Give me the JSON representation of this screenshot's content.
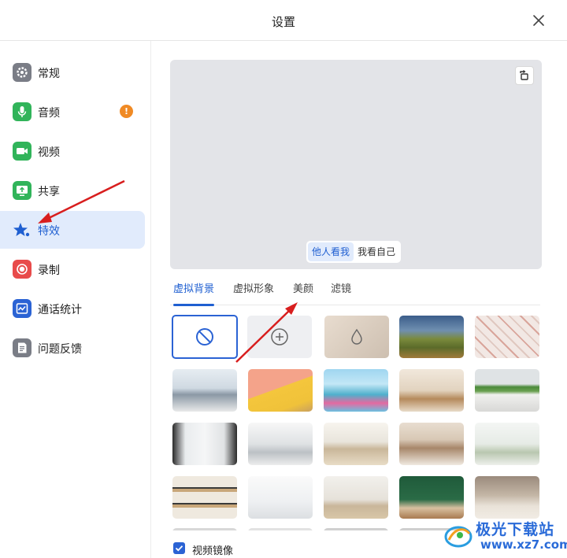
{
  "window": {
    "title": "设置"
  },
  "sidebar": {
    "items": [
      {
        "key": "general",
        "label": "常规",
        "icon": "gear-icon",
        "color": "#7a7d86",
        "active": false
      },
      {
        "key": "audio",
        "label": "音频",
        "icon": "microphone-icon",
        "color": "#31b45a",
        "active": false,
        "badge": "!"
      },
      {
        "key": "video",
        "label": "视频",
        "icon": "camera-icon",
        "color": "#31b45a",
        "active": false
      },
      {
        "key": "share",
        "label": "共享",
        "icon": "screen-share-icon",
        "color": "#31b45a",
        "active": false
      },
      {
        "key": "effects",
        "label": "特效",
        "icon": "star-effects-icon",
        "color": "#1f5fd1",
        "active": true
      },
      {
        "key": "record",
        "label": "录制",
        "icon": "record-icon",
        "color": "#e84b4b",
        "active": false
      },
      {
        "key": "stats",
        "label": "通话统计",
        "icon": "stats-chart-icon",
        "color": "#2b63d4",
        "active": false
      },
      {
        "key": "feedback",
        "label": "问题反馈",
        "icon": "feedback-icon",
        "color": "#7a7d86",
        "active": false
      }
    ]
  },
  "preview": {
    "toggle": [
      {
        "label": "他人看我",
        "active": true
      },
      {
        "label": "我看自己",
        "active": false
      }
    ]
  },
  "tabs": [
    {
      "label": "虚拟背景",
      "active": true
    },
    {
      "label": "虚拟形象",
      "active": false
    },
    {
      "label": "美颜",
      "active": false
    },
    {
      "label": "滤镜",
      "active": false
    }
  ],
  "backgrounds": [
    {
      "name": "none",
      "icon": "no-background-icon",
      "selected": true
    },
    {
      "name": "add",
      "icon": "plus-circle-icon"
    },
    {
      "name": "blur",
      "icon": "blur-drop-icon"
    },
    {
      "name": "landscape"
    },
    {
      "name": "pattern-wall"
    },
    {
      "name": "office-window"
    },
    {
      "name": "color-wall"
    },
    {
      "name": "art-illustration"
    },
    {
      "name": "cafe"
    },
    {
      "name": "office-plants"
    },
    {
      "name": "modern-hall"
    },
    {
      "name": "bright-office"
    },
    {
      "name": "conference-room"
    },
    {
      "name": "meeting-hall"
    },
    {
      "name": "living-room"
    },
    {
      "name": "bookshelf"
    },
    {
      "name": "white-room"
    },
    {
      "name": "empty-room"
    },
    {
      "name": "green-wall"
    },
    {
      "name": "stairs-room"
    }
  ],
  "footer": {
    "mirror_label": "视频镜像",
    "mirror_checked": true
  },
  "watermark": {
    "line1": "极光下载站",
    "line2": "www.xz7.com"
  }
}
